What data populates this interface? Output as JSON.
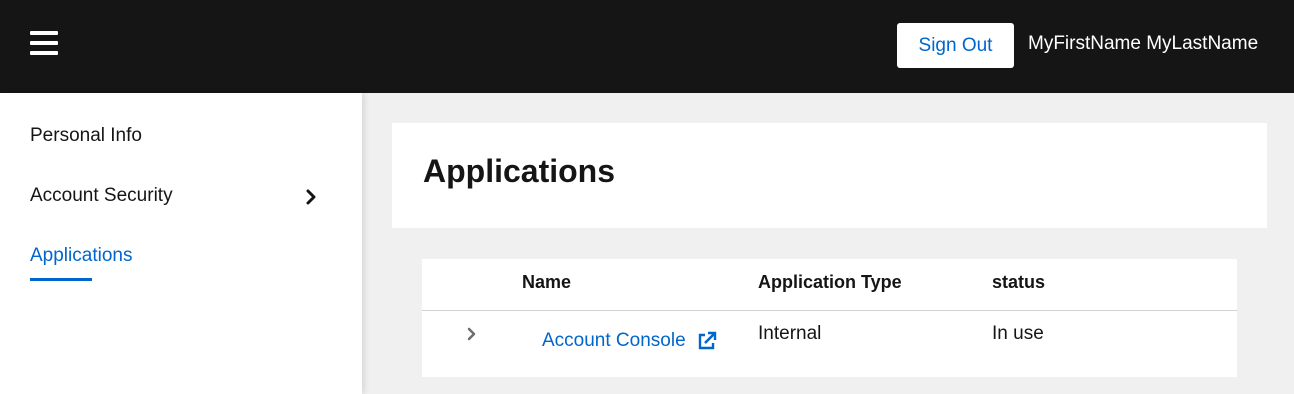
{
  "header": {
    "menu_icon": "hamburger-menu-icon",
    "sign_out_label": "Sign Out",
    "user_name": "MyFirstName MyLastName",
    "background_color": "#151515"
  },
  "sidebar": {
    "items": [
      {
        "label": "Personal Info",
        "active": false
      },
      {
        "label": "Account Security",
        "active": false,
        "expandable": true,
        "icon": "chevron-right-icon"
      },
      {
        "label": "Applications",
        "active": true
      }
    ],
    "active_color": "#0066cc"
  },
  "main": {
    "page_title": "Applications",
    "table": {
      "columns": [
        "Name",
        "Application Type",
        "status"
      ],
      "rows": [
        {
          "name": "Account Console",
          "application_type": "Internal",
          "status": "In use",
          "expand_icon": "chevron-right-icon",
          "link_icon": "external-link-icon"
        }
      ]
    }
  },
  "colors": {
    "accent": "#0066cc",
    "page_background": "#f0f0f0",
    "text": "#151515"
  }
}
